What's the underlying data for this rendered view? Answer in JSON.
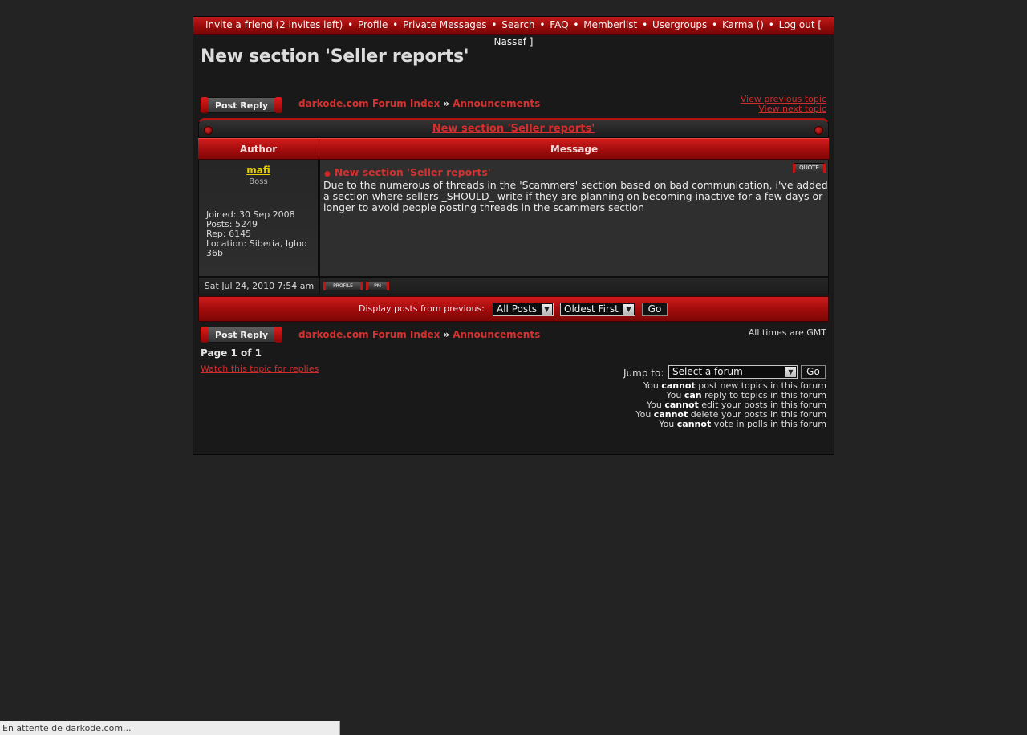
{
  "nav": {
    "invite": "Invite a friend (2 invites left)",
    "profile": "Profile",
    "private_messages": "Private Messages",
    "search": "Search",
    "faq": "FAQ",
    "memberlist": "Memberlist",
    "usergroups": "Usergroups",
    "karma": "Karma ()",
    "logout": "Log out [ Nassef ]",
    "separator": "•"
  },
  "page_title": "New section 'Seller reports'",
  "post_reply_label": "Post Reply",
  "breadcrumb": {
    "forum_index": "darkode.com Forum Index",
    "arrow": "»",
    "section": "Announcements"
  },
  "topic_links": {
    "previous": "View previous topic",
    "next": "View next topic"
  },
  "topic_header": "New section 'Seller reports'",
  "columns": {
    "author": "Author",
    "message": "Message"
  },
  "post": {
    "author": "mafi",
    "rank": "Boss",
    "joined": "Joined: 30 Sep 2008",
    "posts": "Posts: 5249",
    "rep": "Rep: 6145",
    "location": "Location: Siberia, Igloo 36b",
    "subject": "New section 'Seller reports'",
    "body": "Due to the numerous of threads in the 'Scammers' section based on bad communication, i've added a section where sellers _SHOULD_ write if they are planning on becoming inactive for a few days or longer to avoid people posting threads in the scammers section",
    "date": "Sat Jul 24, 2010 7:54 am",
    "quote_label": "QUOTE",
    "profile_label": "PROFILE",
    "pm_label": "PM"
  },
  "display": {
    "label": "Display posts from previous:",
    "period_value": "All Posts",
    "order_value": "Oldest First",
    "go_label": "Go"
  },
  "footer": {
    "all_times": "All times are GMT",
    "page_of": "Page 1 of 1",
    "watch": "Watch this topic for replies",
    "jump_label": "Jump to:",
    "jump_value": "Select a forum",
    "jump_go": "Go"
  },
  "permissions": [
    {
      "pre": "You ",
      "verb": "cannot",
      "post": " post new topics in this forum"
    },
    {
      "pre": "You ",
      "verb": "can",
      "post": " reply to topics in this forum"
    },
    {
      "pre": "You ",
      "verb": "cannot",
      "post": " edit your posts in this forum"
    },
    {
      "pre": "You ",
      "verb": "cannot",
      "post": " delete your posts in this forum"
    },
    {
      "pre": "You ",
      "verb": "cannot",
      "post": " vote in polls in this forum"
    }
  ],
  "status_bar": "En attente de darkode.com...",
  "colors": {
    "background": "#232323",
    "accent_red": "#b11212",
    "link_red": "#d43131",
    "author_gold": "#e8d100"
  },
  "icons": {
    "post_bullet": "red-dot-icon",
    "select_arrow": "chevron-down-icon"
  }
}
